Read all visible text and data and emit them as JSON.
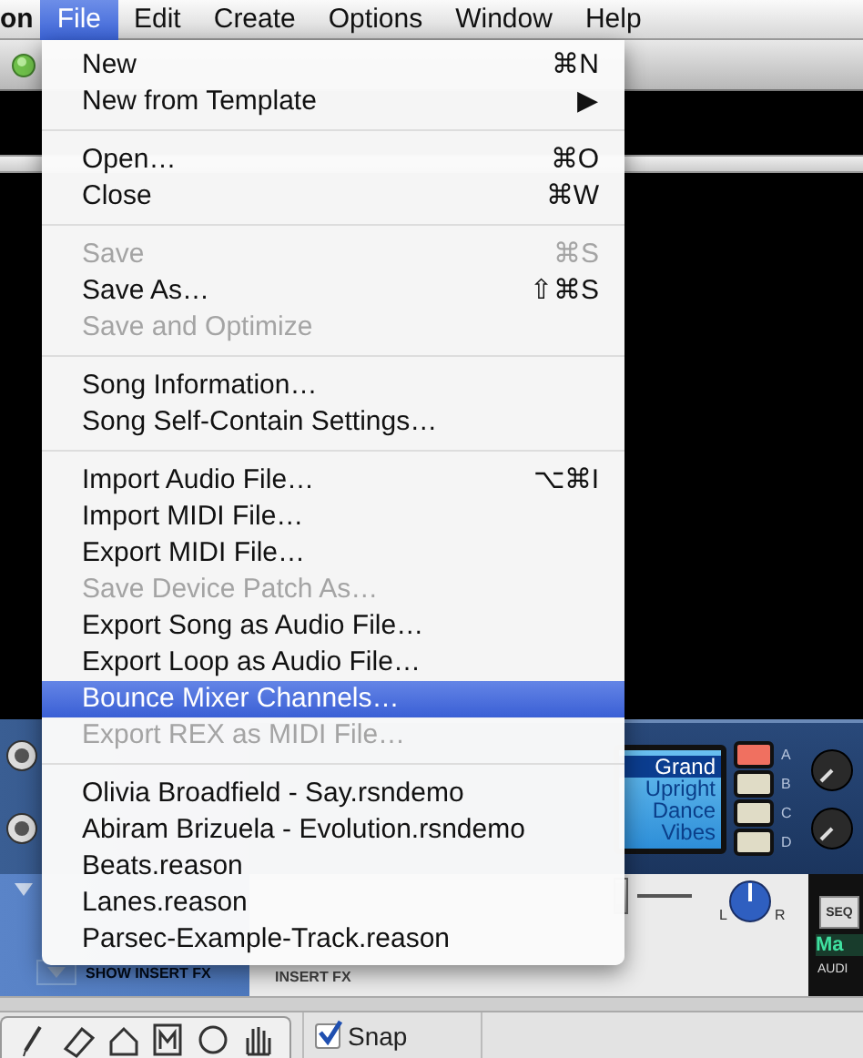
{
  "menubar": {
    "app_name": "on",
    "menus": [
      {
        "label": "File",
        "selected": true
      },
      {
        "label": "Edit",
        "selected": false
      },
      {
        "label": "Create",
        "selected": false
      },
      {
        "label": "Options",
        "selected": false
      },
      {
        "label": "Window",
        "selected": false
      },
      {
        "label": "Help",
        "selected": false
      }
    ]
  },
  "file_menu": {
    "groups": [
      [
        {
          "label": "New",
          "shortcut": "⌘N",
          "disabled": false,
          "selected": false
        },
        {
          "label": "New from Template",
          "shortcut": "▶",
          "disabled": false,
          "selected": false
        }
      ],
      [
        {
          "label": "Open…",
          "shortcut": "⌘O",
          "disabled": false,
          "selected": false
        },
        {
          "label": "Close",
          "shortcut": "⌘W",
          "disabled": false,
          "selected": false
        }
      ],
      [
        {
          "label": "Save",
          "shortcut": "⌘S",
          "disabled": true,
          "selected": false
        },
        {
          "label": "Save As…",
          "shortcut": "⇧⌘S",
          "disabled": false,
          "selected": false
        },
        {
          "label": "Save and Optimize",
          "disabled": true,
          "selected": false
        }
      ],
      [
        {
          "label": "Song Information…",
          "disabled": false,
          "selected": false
        },
        {
          "label": "Song Self-Contain Settings…",
          "disabled": false,
          "selected": false
        }
      ],
      [
        {
          "label": "Import Audio File…",
          "shortcut": "⌥⌘I",
          "disabled": false,
          "selected": false
        },
        {
          "label": "Import MIDI File…",
          "disabled": false,
          "selected": false
        },
        {
          "label": "Export MIDI File…",
          "disabled": false,
          "selected": false
        },
        {
          "label": "Save Device Patch As…",
          "disabled": true,
          "selected": false
        },
        {
          "label": "Export Song as Audio File…",
          "disabled": false,
          "selected": false
        },
        {
          "label": "Export Loop as Audio File…",
          "disabled": false,
          "selected": false
        },
        {
          "label": "Bounce Mixer Channels…",
          "disabled": false,
          "selected": true
        },
        {
          "label": "Export REX as MIDI File…",
          "disabled": true,
          "selected": false
        }
      ],
      [
        {
          "label": "Olivia Broadfield - Say.rsndemo",
          "disabled": false,
          "selected": false
        },
        {
          "label": "Abiram Brizuela - Evolution.rsndemo",
          "disabled": false,
          "selected": false
        },
        {
          "label": "Beats.reason",
          "disabled": false,
          "selected": false
        },
        {
          "label": "Lanes.reason",
          "disabled": false,
          "selected": false
        },
        {
          "label": "Parsec-Example-Track.reason",
          "disabled": false,
          "selected": false
        }
      ]
    ]
  },
  "device": {
    "patches": [
      {
        "label": "Grand",
        "selected": true
      },
      {
        "label": "Upright",
        "selected": false
      },
      {
        "label": "Dance",
        "selected": false
      },
      {
        "label": "Vibes",
        "selected": false
      }
    ],
    "buttons": [
      {
        "label": "A",
        "on": true
      },
      {
        "label": "B",
        "on": false
      },
      {
        "label": "C",
        "on": false
      },
      {
        "label": "D",
        "on": false
      }
    ]
  },
  "mixer": {
    "show_insert_fx": "SHOW INSERT FX",
    "insert_fx_label": "INSERT FX",
    "pan_left": "L",
    "pan_right": "R",
    "seq_button": "SEQ",
    "display_text": "Ma",
    "channel_label": "AUDI"
  },
  "toolbar": {
    "snap": {
      "label": "Snap",
      "checked": true
    }
  }
}
